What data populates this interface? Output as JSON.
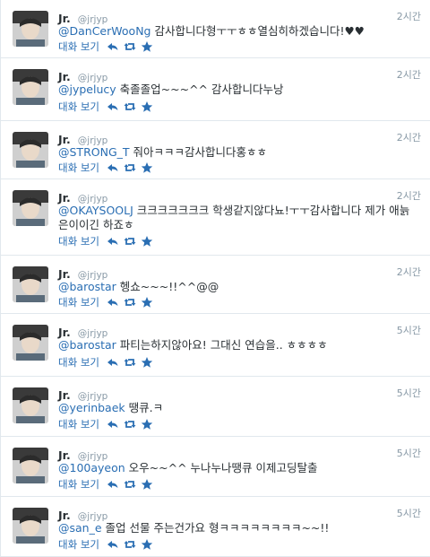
{
  "colors": {
    "link": "#2a6eb3",
    "muted": "#8899a6",
    "text": "#292f33",
    "border": "#e1e8ed"
  },
  "icons": {
    "reply": "reply-arrow-icon",
    "retweet": "retweet-icon",
    "favorite": "star-icon"
  },
  "tweets": [
    {
      "name": "Jr.",
      "handle": "@jrjyp",
      "time": "2시간",
      "mention": "@DanCerWooNg",
      "body": " 감사합니다형ㅜㅜㅎㅎ열심히하겠습니다!♥♥",
      "conversation": "대화 보기"
    },
    {
      "name": "Jr.",
      "handle": "@jrjyp",
      "time": "2시간",
      "mention": "@jypelucy",
      "body": " 축졸졸업~~~^^ 감사합니다누낭",
      "conversation": "대화 보기"
    },
    {
      "name": "Jr.",
      "handle": "@jrjyp",
      "time": "2시간",
      "mention": "@STRONG_T",
      "body": " 줘아ㅋㅋㅋ감사합니다홍ㅎㅎ",
      "conversation": "대화 보기"
    },
    {
      "name": "Jr.",
      "handle": "@jrjyp",
      "time": "2시간",
      "mention": "@OKAYSOOLJ",
      "body": " 크크크크크크크 학생같지않다뇨!ㅜㅜ감사합니다 제가 애늙은이이긴 하죠ㅎ",
      "conversation": "대화 보기"
    },
    {
      "name": "Jr.",
      "handle": "@jrjyp",
      "time": "2시간",
      "mention": "@barostar",
      "body": " 헹쇼~~~!!^^@@",
      "conversation": "대화 보기"
    },
    {
      "name": "Jr.",
      "handle": "@jrjyp",
      "time": "5시간",
      "mention": "@barostar",
      "body": " 파티는하지않아요! 그대신 연습을.. ㅎㅎㅎㅎ",
      "conversation": "대화 보기"
    },
    {
      "name": "Jr.",
      "handle": "@jrjyp",
      "time": "5시간",
      "mention": "@yerinbaek",
      "body": " 땡큐.ㅋ",
      "conversation": "대화 보기"
    },
    {
      "name": "Jr.",
      "handle": "@jrjyp",
      "time": "5시간",
      "mention": "@100ayeon",
      "body": " 오우~~^^ 누나누나땡큐 이제고딩탈출",
      "conversation": "대화 보기"
    },
    {
      "name": "Jr.",
      "handle": "@jrjyp",
      "time": "5시간",
      "mention": "@san_e",
      "body": " 졸업 선물 주는건가요 형ㅋㅋㅋㅋㅋㅋㅋㅋ~~!!",
      "conversation": "대화 보기"
    }
  ]
}
